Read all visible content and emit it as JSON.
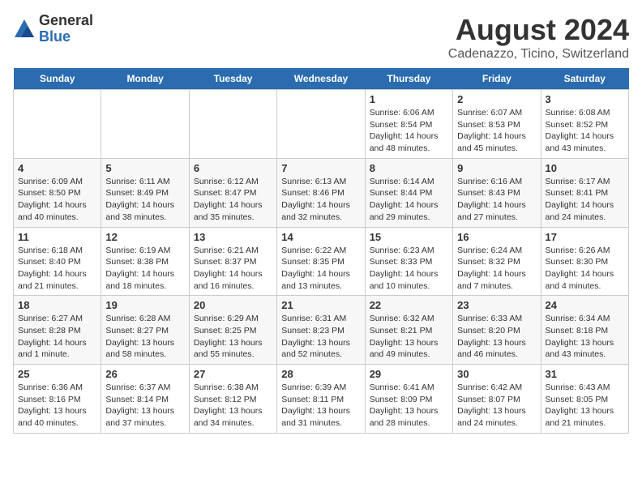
{
  "logo": {
    "general": "General",
    "blue": "Blue"
  },
  "title": "August 2024",
  "subtitle": "Cadenazzo, Ticino, Switzerland",
  "headers": [
    "Sunday",
    "Monday",
    "Tuesday",
    "Wednesday",
    "Thursday",
    "Friday",
    "Saturday"
  ],
  "weeks": [
    [
      {
        "day": "",
        "content": ""
      },
      {
        "day": "",
        "content": ""
      },
      {
        "day": "",
        "content": ""
      },
      {
        "day": "",
        "content": ""
      },
      {
        "day": "1",
        "content": "Sunrise: 6:06 AM\nSunset: 8:54 PM\nDaylight: 14 hours and 48 minutes."
      },
      {
        "day": "2",
        "content": "Sunrise: 6:07 AM\nSunset: 8:53 PM\nDaylight: 14 hours and 45 minutes."
      },
      {
        "day": "3",
        "content": "Sunrise: 6:08 AM\nSunset: 8:52 PM\nDaylight: 14 hours and 43 minutes."
      }
    ],
    [
      {
        "day": "4",
        "content": "Sunrise: 6:09 AM\nSunset: 8:50 PM\nDaylight: 14 hours and 40 minutes."
      },
      {
        "day": "5",
        "content": "Sunrise: 6:11 AM\nSunset: 8:49 PM\nDaylight: 14 hours and 38 minutes."
      },
      {
        "day": "6",
        "content": "Sunrise: 6:12 AM\nSunset: 8:47 PM\nDaylight: 14 hours and 35 minutes."
      },
      {
        "day": "7",
        "content": "Sunrise: 6:13 AM\nSunset: 8:46 PM\nDaylight: 14 hours and 32 minutes."
      },
      {
        "day": "8",
        "content": "Sunrise: 6:14 AM\nSunset: 8:44 PM\nDaylight: 14 hours and 29 minutes."
      },
      {
        "day": "9",
        "content": "Sunrise: 6:16 AM\nSunset: 8:43 PM\nDaylight: 14 hours and 27 minutes."
      },
      {
        "day": "10",
        "content": "Sunrise: 6:17 AM\nSunset: 8:41 PM\nDaylight: 14 hours and 24 minutes."
      }
    ],
    [
      {
        "day": "11",
        "content": "Sunrise: 6:18 AM\nSunset: 8:40 PM\nDaylight: 14 hours and 21 minutes."
      },
      {
        "day": "12",
        "content": "Sunrise: 6:19 AM\nSunset: 8:38 PM\nDaylight: 14 hours and 18 minutes."
      },
      {
        "day": "13",
        "content": "Sunrise: 6:21 AM\nSunset: 8:37 PM\nDaylight: 14 hours and 16 minutes."
      },
      {
        "day": "14",
        "content": "Sunrise: 6:22 AM\nSunset: 8:35 PM\nDaylight: 14 hours and 13 minutes."
      },
      {
        "day": "15",
        "content": "Sunrise: 6:23 AM\nSunset: 8:33 PM\nDaylight: 14 hours and 10 minutes."
      },
      {
        "day": "16",
        "content": "Sunrise: 6:24 AM\nSunset: 8:32 PM\nDaylight: 14 hours and 7 minutes."
      },
      {
        "day": "17",
        "content": "Sunrise: 6:26 AM\nSunset: 8:30 PM\nDaylight: 14 hours and 4 minutes."
      }
    ],
    [
      {
        "day": "18",
        "content": "Sunrise: 6:27 AM\nSunset: 8:28 PM\nDaylight: 14 hours and 1 minute."
      },
      {
        "day": "19",
        "content": "Sunrise: 6:28 AM\nSunset: 8:27 PM\nDaylight: 13 hours and 58 minutes."
      },
      {
        "day": "20",
        "content": "Sunrise: 6:29 AM\nSunset: 8:25 PM\nDaylight: 13 hours and 55 minutes."
      },
      {
        "day": "21",
        "content": "Sunrise: 6:31 AM\nSunset: 8:23 PM\nDaylight: 13 hours and 52 minutes."
      },
      {
        "day": "22",
        "content": "Sunrise: 6:32 AM\nSunset: 8:21 PM\nDaylight: 13 hours and 49 minutes."
      },
      {
        "day": "23",
        "content": "Sunrise: 6:33 AM\nSunset: 8:20 PM\nDaylight: 13 hours and 46 minutes."
      },
      {
        "day": "24",
        "content": "Sunrise: 6:34 AM\nSunset: 8:18 PM\nDaylight: 13 hours and 43 minutes."
      }
    ],
    [
      {
        "day": "25",
        "content": "Sunrise: 6:36 AM\nSunset: 8:16 PM\nDaylight: 13 hours and 40 minutes."
      },
      {
        "day": "26",
        "content": "Sunrise: 6:37 AM\nSunset: 8:14 PM\nDaylight: 13 hours and 37 minutes."
      },
      {
        "day": "27",
        "content": "Sunrise: 6:38 AM\nSunset: 8:12 PM\nDaylight: 13 hours and 34 minutes."
      },
      {
        "day": "28",
        "content": "Sunrise: 6:39 AM\nSunset: 8:11 PM\nDaylight: 13 hours and 31 minutes."
      },
      {
        "day": "29",
        "content": "Sunrise: 6:41 AM\nSunset: 8:09 PM\nDaylight: 13 hours and 28 minutes."
      },
      {
        "day": "30",
        "content": "Sunrise: 6:42 AM\nSunset: 8:07 PM\nDaylight: 13 hours and 24 minutes."
      },
      {
        "day": "31",
        "content": "Sunrise: 6:43 AM\nSunset: 8:05 PM\nDaylight: 13 hours and 21 minutes."
      }
    ]
  ]
}
